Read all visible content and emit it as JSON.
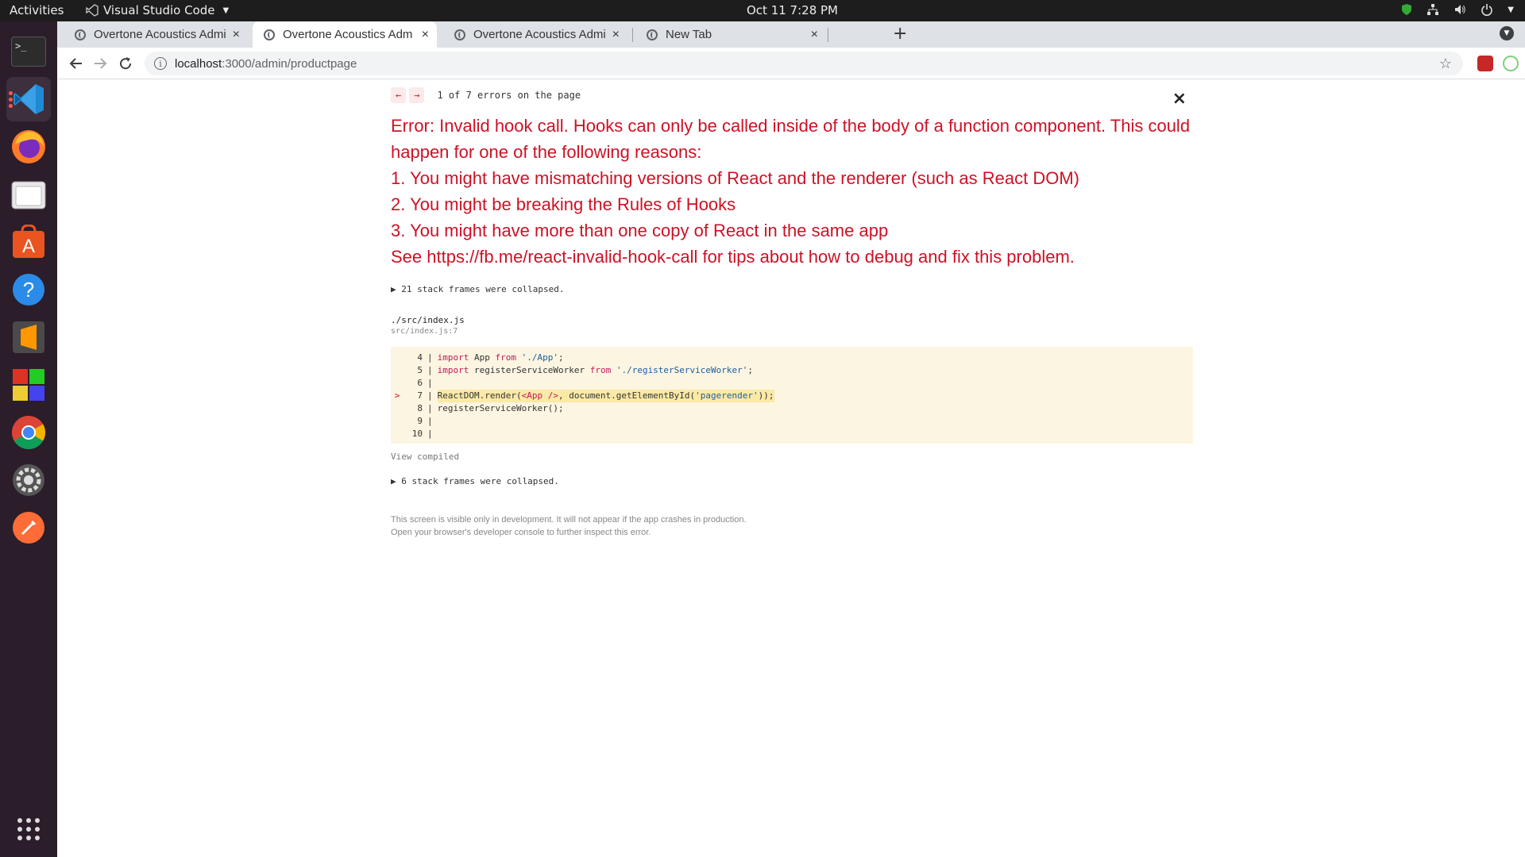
{
  "topbar": {
    "activities": "Activities",
    "app_name": "Visual Studio Code",
    "clock": "Oct 11  7:28 PM"
  },
  "dock": {
    "items": [
      {
        "name": "terminal",
        "icon": "terminal-icon"
      },
      {
        "name": "vscode",
        "icon": "vscode-icon"
      },
      {
        "name": "firefox",
        "icon": "firefox-icon"
      },
      {
        "name": "files",
        "icon": "files-icon"
      },
      {
        "name": "software",
        "icon": "software-center-icon"
      },
      {
        "name": "help",
        "icon": "help-icon"
      },
      {
        "name": "sublime",
        "icon": "sublime-text-icon"
      },
      {
        "name": "app-grid-colors",
        "icon": "office-icon"
      },
      {
        "name": "chrome",
        "icon": "chrome-icon"
      },
      {
        "name": "settings",
        "icon": "settings-icon"
      },
      {
        "name": "postman",
        "icon": "postman-icon"
      }
    ],
    "show_apps_icon": "show-applications-icon"
  },
  "browser": {
    "tabs": [
      {
        "title": "Overtone Acoustics Admi",
        "active": false
      },
      {
        "title": "Overtone Acoustics Adm",
        "active": true
      },
      {
        "title": "Overtone Acoustics Admi",
        "active": false
      },
      {
        "title": "New Tab",
        "active": false
      }
    ],
    "new_tab": "+",
    "close_glyph": "×",
    "url_host": "localhost",
    "url_path": ":3000/admin/productpage"
  },
  "error": {
    "counter": "1 of 7 errors on the page",
    "prev": "←",
    "next": "→",
    "close": "×",
    "lines": [
      "Error: Invalid hook call. Hooks can only be called inside of the body of a function component. This could happen for one of the following reasons:",
      "1. You might have mismatching versions of React and the renderer (such as React DOM)",
      "2. You might be breaking the Rules of Hooks",
      "3. You might have more than one copy of React in the same app",
      "See https://fb.me/react-invalid-hook-call for tips about how to debug and fix this problem."
    ],
    "collapsed_top": "▶ 21 stack frames were collapsed.",
    "file": "./src/index.js",
    "file_loc": "src/index.js:7",
    "code": [
      {
        "marker": "",
        "num": "4",
        "text": "import App from './App';"
      },
      {
        "marker": "",
        "num": "5",
        "text": "import registerServiceWorker from './registerServiceWorker';"
      },
      {
        "marker": "",
        "num": "6",
        "text": ""
      },
      {
        "marker": ">",
        "num": "7",
        "text": "ReactDOM.render(<App />, document.getElementById('pagerender'));"
      },
      {
        "marker": "",
        "num": "8",
        "text": "registerServiceWorker();"
      },
      {
        "marker": "",
        "num": "9",
        "text": ""
      },
      {
        "marker": "",
        "num": "10",
        "text": ""
      }
    ],
    "view_compiled": "View compiled",
    "collapsed_bottom": "▶ 6 stack frames were collapsed.",
    "footer_1": "This screen is visible only in development. It will not appear if the app crashes in production.",
    "footer_2": "Open your browser's developer console to further inspect this error."
  },
  "colors": {
    "error_red": "#ce1126",
    "code_bg": "#fbf5e1",
    "dock_bg": "#2b1d2a"
  }
}
